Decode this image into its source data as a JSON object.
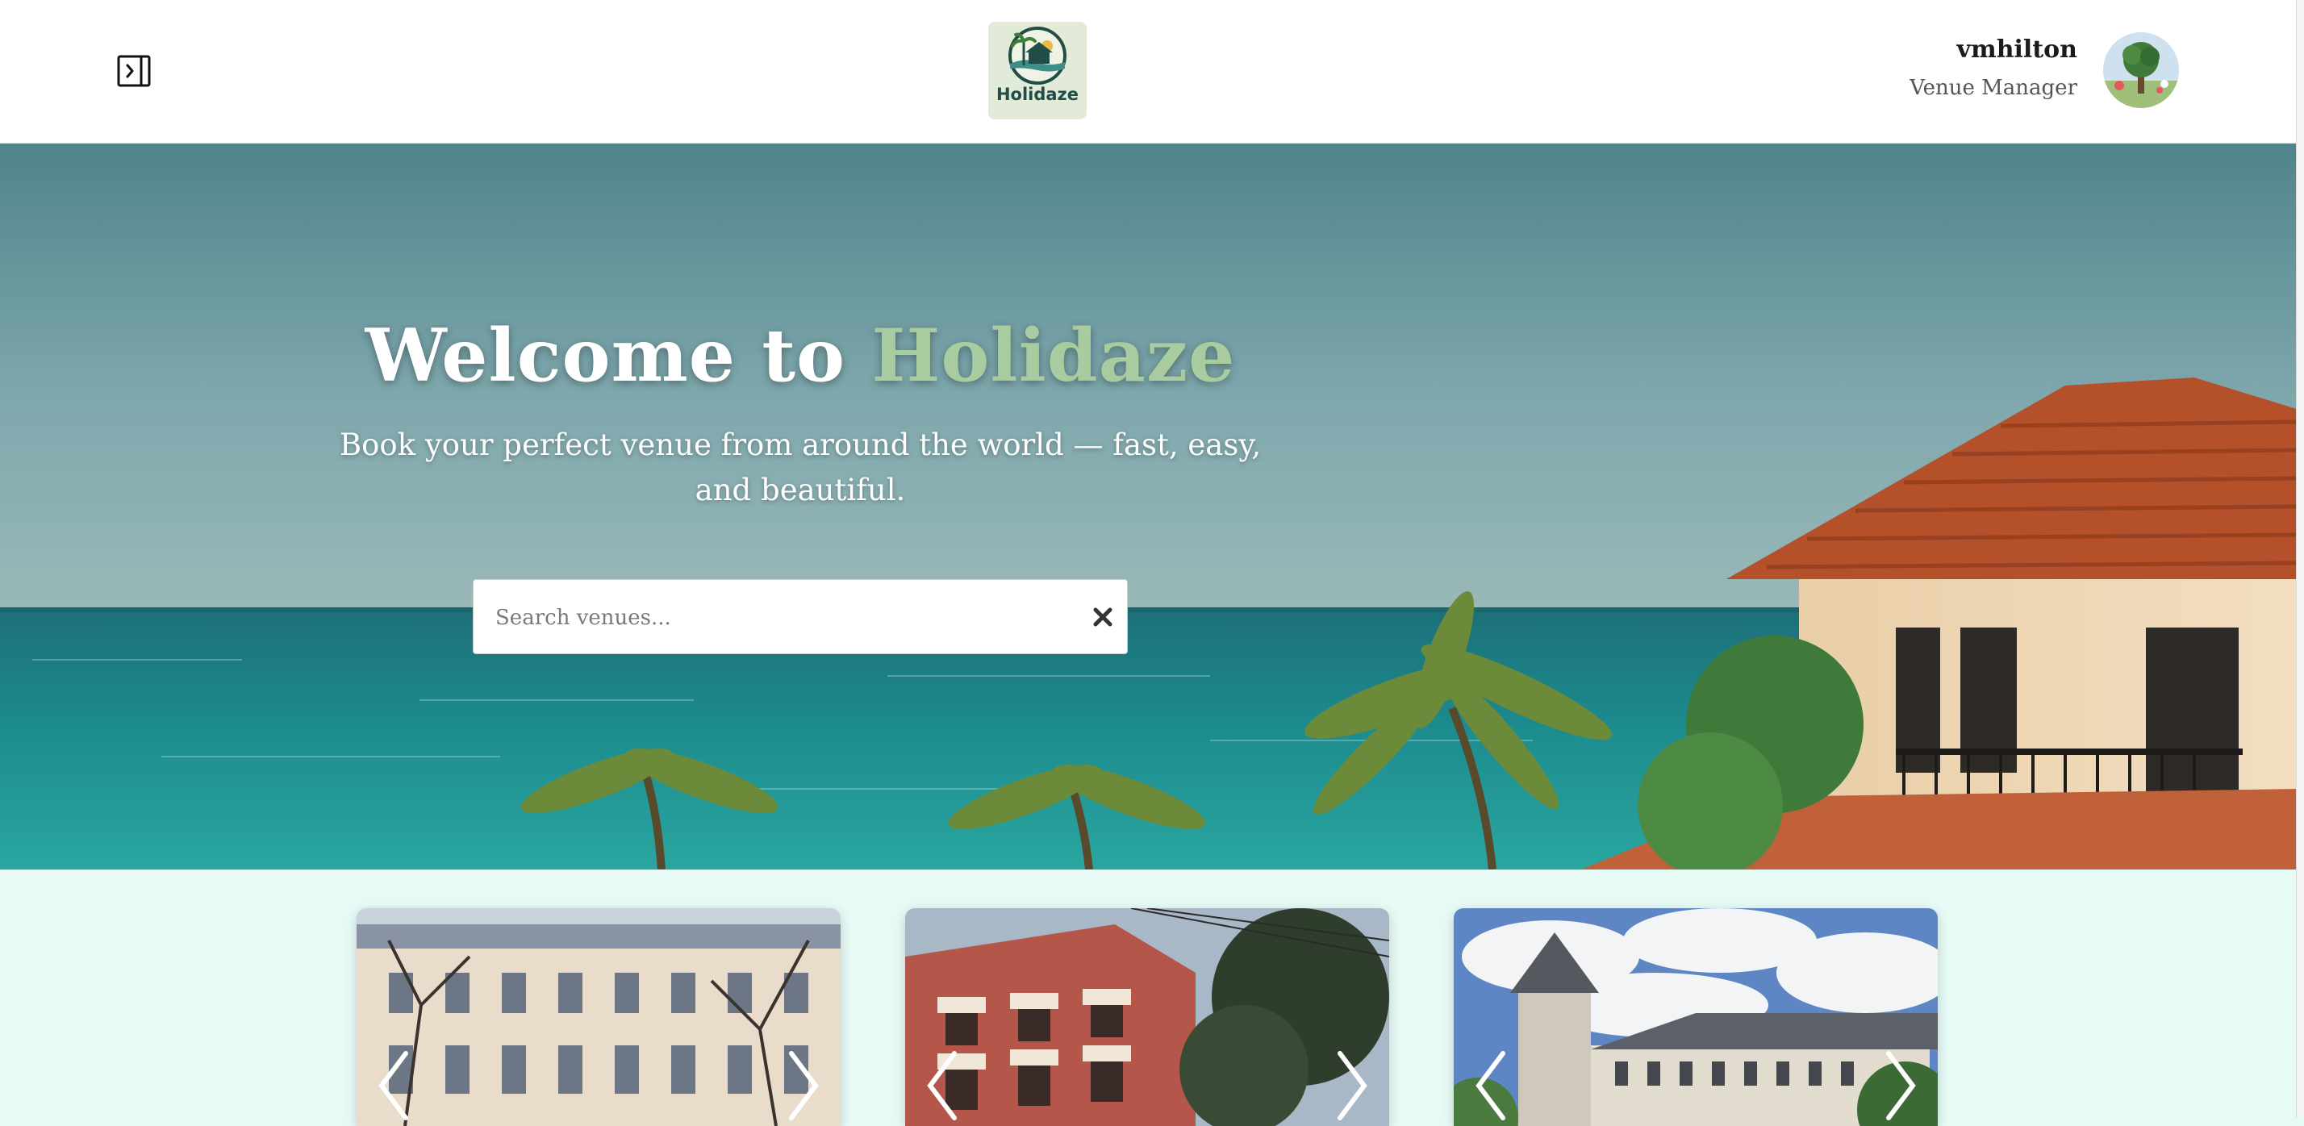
{
  "header": {
    "brand_name": "Holidaze",
    "user": {
      "username": "vmhilton",
      "role": "Venue Manager"
    }
  },
  "hero": {
    "title_prefix": "Welcome to",
    "title_brand": "Holidaze",
    "subtitle": "Book your perfect venue from around the world — fast, easy, and beautiful.",
    "search": {
      "placeholder": "Search venues...",
      "value": ""
    }
  },
  "icons": {
    "sidebar_toggle": "sidebar-toggle-icon",
    "clear_search": "close-icon",
    "carousel_prev": "chevron-left-icon",
    "carousel_next": "chevron-right-icon"
  },
  "colors": {
    "brand_accent": "#a9cba0",
    "brand_dark": "#214d47",
    "page_background": "#e6faf6",
    "header_background": "#ffffff"
  }
}
